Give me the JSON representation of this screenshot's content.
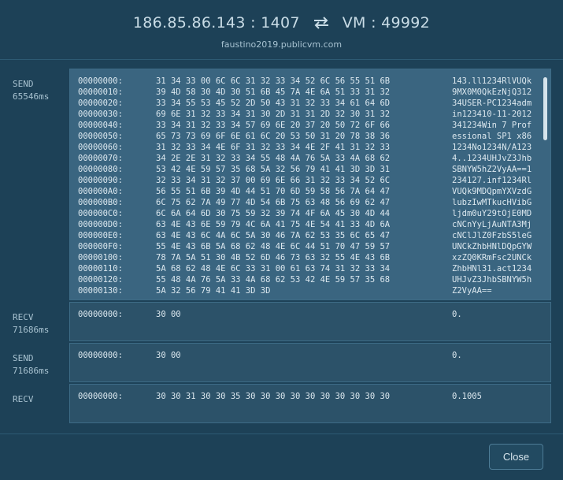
{
  "header": {
    "remote": "186.85.86.143 : 1407",
    "vm": "VM : 49992",
    "host": "faustino2019.publicvm.com",
    "swap_icon": "swap-arrows-icon"
  },
  "packets": [
    {
      "direction": "SEND",
      "time": "65546ms",
      "rows": [
        {
          "off": "00000000:",
          "hex": "31 34 33 00 6C 6C 31 32 33 34 52 6C 56 55 51 6B",
          "asc": "143.ll1234RlVUQk"
        },
        {
          "off": "00000010:",
          "hex": "39 4D 58 30 4D 30 51 6B 45 7A 4E 6A 51 33 31 32",
          "asc": "9MX0M0QkEzNjQ312"
        },
        {
          "off": "00000020:",
          "hex": "33 34 55 53 45 52 2D 50 43 31 32 33 34 61 64 6D",
          "asc": "34USER-PC1234adm"
        },
        {
          "off": "00000030:",
          "hex": "69 6E 31 32 33 34 31 30 2D 31 31 2D 32 30 31 32",
          "asc": "in123410-11-2012"
        },
        {
          "off": "00000040:",
          "hex": "33 34 31 32 33 34 57 69 6E 20 37 20 50 72 6F 66",
          "asc": "341234Win 7 Prof"
        },
        {
          "off": "00000050:",
          "hex": "65 73 73 69 6F 6E 61 6C 20 53 50 31 20 78 38 36",
          "asc": "essional SP1 x86"
        },
        {
          "off": "00000060:",
          "hex": "31 32 33 34 4E 6F 31 32 33 34 4E 2F 41 31 32 33",
          "asc": "1234No1234N/A123"
        },
        {
          "off": "00000070:",
          "hex": "34 2E 2E 31 32 33 34 55 48 4A 76 5A 33 4A 68 62",
          "asc": "4..1234UHJvZ3Jhb"
        },
        {
          "off": "00000080:",
          "hex": "53 42 4E 59 57 35 68 5A 32 56 79 41 41 3D 3D 31",
          "asc": "SBNYW5hZ2VyAA==1"
        },
        {
          "off": "00000090:",
          "hex": "32 33 34 31 32 37 00 69 6E 66 31 32 33 34 52 6C",
          "asc": "234127.inf1234Rl"
        },
        {
          "off": "000000A0:",
          "hex": "56 55 51 6B 39 4D 44 51 70 6D 59 58 56 7A 64 47",
          "asc": "VUQk9MDQpmYXVzdG"
        },
        {
          "off": "000000B0:",
          "hex": "6C 75 62 7A 49 77 4D 54 6B 75 63 48 56 69 62 47",
          "asc": "lubzIwMTkucHVibG"
        },
        {
          "off": "000000C0:",
          "hex": "6C 6A 64 6D 30 75 59 32 39 74 4F 6A 45 30 4D 44",
          "asc": "ljdm0uY29tOjE0MD"
        },
        {
          "off": "000000D0:",
          "hex": "63 4E 43 6E 59 79 4C 6A 41 75 4E 54 41 33 4D 6A",
          "asc": "cNCnYyLjAuNTA3Mj"
        },
        {
          "off": "000000E0:",
          "hex": "63 4E 43 6C 4A 6C 5A 30 46 7A 62 53 35 6C 65 47",
          "asc": "cNClJlZ0FzbS5leG"
        },
        {
          "off": "000000F0:",
          "hex": "55 4E 43 6B 5A 68 62 48 4E 6C 44 51 70 47 59 57",
          "asc": "UNCkZhbHNlDQpGYW"
        },
        {
          "off": "00000100:",
          "hex": "78 7A 5A 51 30 4B 52 6D 46 73 63 32 55 4E 43 6B",
          "asc": "xzZQ0KRmFsc2UNCk"
        },
        {
          "off": "00000110:",
          "hex": "5A 68 62 48 4E 6C 33 31 00 61 63 74 31 32 33 34",
          "asc": "ZhbHNl31.act1234"
        },
        {
          "off": "00000120:",
          "hex": "55 48 4A 76 5A 33 4A 68 62 53 42 4E 59 57 35 68",
          "asc": "UHJvZ3JhbSBNYW5h"
        },
        {
          "off": "00000130:",
          "hex": "5A 32 56 79 41 41 3D 3D",
          "asc": "Z2VyAA=="
        }
      ]
    },
    {
      "direction": "RECV",
      "time": "71686ms",
      "rows": [
        {
          "off": "00000000:",
          "hex": "30 00",
          "asc": "0."
        }
      ]
    },
    {
      "direction": "SEND",
      "time": "71686ms",
      "rows": [
        {
          "off": "00000000:",
          "hex": "30 00",
          "asc": "0."
        }
      ]
    },
    {
      "direction": "RECV",
      "time": "",
      "rows": [
        {
          "off": "00000000:",
          "hex": "30 30 31 30 30 35 30 30 30 30 30 30 30 30 30 30",
          "asc": "0.1005"
        }
      ]
    }
  ],
  "footer": {
    "close_label": "Close"
  }
}
